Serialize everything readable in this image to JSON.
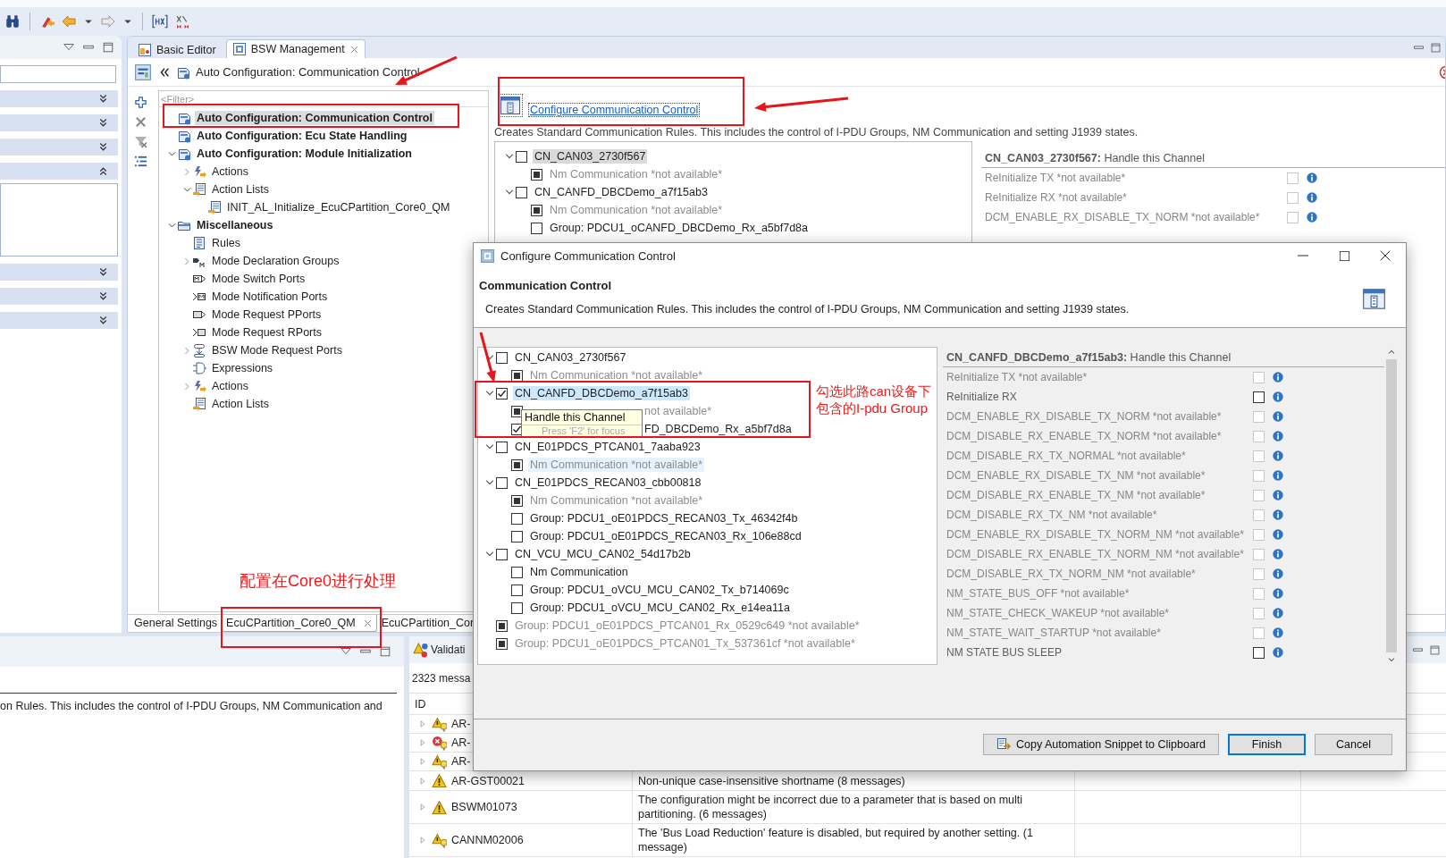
{
  "left_panel": {
    "sections": [
      {
        "expanded": false
      },
      {
        "expanded": false
      },
      {
        "expanded": false
      },
      {
        "expanded": true
      },
      {
        "expanded": false
      },
      {
        "expanded": false
      },
      {
        "expanded": false
      }
    ]
  },
  "editor": {
    "tabs": [
      {
        "label": "Basic Editor",
        "selected": false,
        "closable": false
      },
      {
        "label": "BSW Management",
        "selected": true,
        "closable": true
      }
    ],
    "breadcrumb": "Auto Configuration: Communication Control",
    "filter": {
      "placeholder": "<Filter>"
    },
    "tree": [
      {
        "label": "Auto Configuration: Communication Control",
        "kind": "autoconfig",
        "bold": true,
        "selected": true
      },
      {
        "label": "Auto Configuration: Ecu State Handling",
        "kind": "autoconfig",
        "bold": true,
        "selected": false
      },
      {
        "label": "Auto Configuration: Module Initialization",
        "kind": "autoconfig",
        "bold": true,
        "selected": false,
        "expanded": true,
        "children": [
          {
            "label": "Actions",
            "kind": "actions",
            "bold": false,
            "selected": false,
            "expanded": false
          },
          {
            "label": "Action Lists",
            "kind": "action-list",
            "bold": false,
            "selected": false,
            "expanded": true,
            "children": [
              {
                "label": "INIT_AL_Initialize_EcuCPartition_Core0_QM",
                "kind": "action-list",
                "bold": false,
                "selected": false
              }
            ]
          }
        ]
      },
      {
        "label": "Miscellaneous",
        "kind": "folder",
        "bold": true,
        "selected": false,
        "expanded": true,
        "children": [
          {
            "label": "Rules",
            "kind": "rules",
            "bold": false,
            "selected": false
          },
          {
            "label": "Mode Declaration Groups",
            "kind": "mode-group",
            "bold": false,
            "selected": false,
            "expanded": false
          },
          {
            "label": "Mode Switch Ports",
            "kind": "mode-switch",
            "bold": false,
            "selected": false
          },
          {
            "label": "Mode Notification Ports",
            "kind": "mode-notification",
            "bold": false,
            "selected": false
          },
          {
            "label": "Mode Request PPorts",
            "kind": "mode-request-p",
            "bold": false,
            "selected": false
          },
          {
            "label": "Mode Request RPorts",
            "kind": "mode-request-r",
            "bold": false,
            "selected": false
          },
          {
            "label": "BSW Mode Request Ports",
            "kind": "bsw-request",
            "bold": false,
            "selected": false,
            "expanded": false
          },
          {
            "label": "Expressions",
            "kind": "expression",
            "bold": false,
            "selected": false
          },
          {
            "label": "Actions",
            "kind": "actions",
            "bold": false,
            "selected": false,
            "expanded": false
          },
          {
            "label": "Action Lists",
            "kind": "action-list",
            "bold": false,
            "selected": false
          }
        ]
      }
    ],
    "link": "Configure Communication Control",
    "description": "Creates Standard Communication Rules. This includes the control of I-PDU Groups, NM Communication and setting J1939 states.",
    "channels": [
      {
        "label": "CN_CAN03_2730f567",
        "checked": false,
        "available": true,
        "selected": true,
        "expanded": true,
        "children": [
          {
            "label": "Nm Communication *not available*",
            "checked": false,
            "available": false,
            "selected": false
          }
        ]
      },
      {
        "label": "CN_CANFD_DBCDemo_a7f15ab3",
        "checked": false,
        "available": true,
        "selected": false,
        "expanded": true,
        "children": [
          {
            "label": "Nm Communication *not available*",
            "checked": false,
            "available": false,
            "selected": false
          },
          {
            "label": "Group: PDCU1_oCANFD_DBCDemo_Rx_a5bf7d8a",
            "checked": false,
            "available": true,
            "selected": false
          }
        ]
      }
    ],
    "detail": {
      "heading": "**CN_CAN03_2730f567:** Handle this Channel",
      "rows": [
        {
          "label": "ReInitialize TX *not available*",
          "checked": false,
          "available": false
        },
        {
          "label": "ReInitialize RX *not available*",
          "checked": false,
          "available": false
        },
        {
          "label": "DCM_ENABLE_RX_DISABLE_TX_NORM *not available*",
          "checked": false,
          "available": false
        }
      ]
    },
    "bottom_tabs": [
      {
        "label": "General Settings",
        "selected": false,
        "closable": false
      },
      {
        "label": "EcuCPartition_Core0_QM",
        "selected": true,
        "closable": true
      },
      {
        "label": "EcuCPartition_Cor",
        "selected": false,
        "closable": false
      }
    ]
  },
  "properties": {
    "text": "on Rules. This includes the control of I-PDU Groups, NM Communication and"
  },
  "validation": {
    "title": "Validati",
    "summary": "2323 messa",
    "columns": [
      "ID"
    ],
    "rows": [
      {
        "id": "AR-",
        "kind": "warning-hint",
        "expanded": false
      },
      {
        "id": "AR-",
        "kind": "error-hint",
        "expanded": false
      },
      {
        "id": "AR-",
        "kind": "warning-hint",
        "expanded": false
      },
      {
        "id": "AR-GST00021",
        "kind": "warning",
        "expanded": false,
        "description": "Non-unique case-insensitive shortname (8 messages)"
      },
      {
        "id": "BSWM01073",
        "kind": "warning",
        "expanded": false,
        "description": "The configuration might be incorrect due to a parameter that is based on multi partitioning. (6 messages)"
      },
      {
        "id": "CANNM02006",
        "kind": "warning-hint",
        "expanded": false,
        "description": "The 'Bus Load Reduction' feature is disabled, but required by another setting. (1 message)"
      }
    ]
  },
  "dialog": {
    "title": "Configure Communication Control",
    "heading": "Communication Control",
    "description": "Creates Standard Communication Rules. This includes the control of I-PDU Groups, NM Communication and setting J1939 states.",
    "channels": [
      {
        "label": "CN_CAN03_2730f567",
        "checked": false,
        "available": true,
        "selected": false,
        "hovered": false,
        "expanded": true,
        "children": [
          {
            "label": "Nm Communication *not available*",
            "checked": false,
            "available": false,
            "selected": false,
            "hovered": false
          }
        ]
      },
      {
        "label": "CN_CANFD_DBCDemo_a7f15ab3",
        "checked": true,
        "available": true,
        "selected": true,
        "hovered": false,
        "expanded": true,
        "children": [
          {
            "label": "not available*",
            "checked": false,
            "available": false,
            "selected": false,
            "hovered": false,
            "covered": true
          },
          {
            "label": "FD_DBCDemo_Rx_a5bf7d8a",
            "checked": true,
            "available": true,
            "selected": false,
            "hovered": false,
            "covered": true
          }
        ]
      },
      {
        "label": "CN_E01PDCS_PTCAN01_7aaba923",
        "checked": false,
        "available": true,
        "selected": false,
        "hovered": false,
        "expanded": true,
        "children": [
          {
            "label": "Nm Communication *not available*",
            "checked": false,
            "available": false,
            "selected": false,
            "hovered": true
          }
        ]
      },
      {
        "label": "CN_E01PDCS_RECAN03_cbb00818",
        "checked": false,
        "available": true,
        "selected": false,
        "hovered": false,
        "expanded": true,
        "children": [
          {
            "label": "Nm Communication *not available*",
            "checked": false,
            "available": false,
            "selected": false,
            "hovered": false
          },
          {
            "label": "Group: PDCU1_oE01PDCS_RECAN03_Tx_46342f4b",
            "checked": false,
            "available": true,
            "selected": false,
            "hovered": false
          },
          {
            "label": "Group: PDCU1_oE01PDCS_RECAN03_Rx_106e88cd",
            "checked": false,
            "available": true,
            "selected": false,
            "hovered": false
          }
        ]
      },
      {
        "label": "CN_VCU_MCU_CAN02_54d17b2b",
        "checked": false,
        "available": true,
        "selected": false,
        "hovered": false,
        "expanded": true,
        "children": [
          {
            "label": "Nm Communication",
            "checked": false,
            "available": true,
            "selected": false,
            "hovered": false
          },
          {
            "label": "Group: PDCU1_oVCU_MCU_CAN02_Tx_b714069c",
            "checked": false,
            "available": true,
            "selected": false,
            "hovered": false
          },
          {
            "label": "Group: PDCU1_oVCU_MCU_CAN02_Rx_e14ea11a",
            "checked": false,
            "available": true,
            "selected": false,
            "hovered": false
          }
        ]
      },
      {
        "label": "Group: PDCU1_oE01PDCS_PTCAN01_Rx_0529c649 *not available*",
        "checked": false,
        "available": false,
        "selected": false,
        "hovered": false
      },
      {
        "label": "Group: PDCU1_oE01PDCS_PTCAN01_Tx_537361cf *not available*",
        "checked": false,
        "available": false,
        "selected": false,
        "hovered": false
      }
    ],
    "tooltip": {
      "title": "Handle this Channel",
      "hint": "Press 'F2' for focus"
    },
    "detail": {
      "heading": "**CN_CANFD_DBCDemo_a7f15ab3:** Handle this Channel",
      "rows": [
        {
          "label": "ReInitialize TX *not available*",
          "checked": false,
          "available": false
        },
        {
          "label": "ReInitialize RX",
          "checked": false,
          "available": true
        },
        {
          "label": "DCM_ENABLE_RX_DISABLE_TX_NORM *not available*",
          "checked": false,
          "available": false
        },
        {
          "label": "DCM_DISABLE_RX_ENABLE_TX_NORM *not available*",
          "checked": false,
          "available": false
        },
        {
          "label": "DCM_DISABLE_RX_TX_NORMAL *not available*",
          "checked": false,
          "available": false
        },
        {
          "label": "DCM_ENABLE_RX_DISABLE_TX_NM *not available*",
          "checked": false,
          "available": false
        },
        {
          "label": "DCM_DISABLE_RX_ENABLE_TX_NM *not available*",
          "checked": false,
          "available": false
        },
        {
          "label": "DCM_DISABLE_RX_TX_NM *not available*",
          "checked": false,
          "available": false
        },
        {
          "label": "DCM_ENABLE_RX_DISABLE_TX_NORM_NM *not available*",
          "checked": false,
          "available": false
        },
        {
          "label": "DCM_DISABLE_RX_ENABLE_TX_NORM_NM *not available*",
          "checked": false,
          "available": false
        },
        {
          "label": "DCM_DISABLE_RX_TX_NORM_NM *not available*",
          "checked": false,
          "available": false
        },
        {
          "label": "NM_STATE_BUS_OFF *not available*",
          "checked": false,
          "available": false
        },
        {
          "label": "NM_STATE_CHECK_WAKEUP *not available*",
          "checked": false,
          "available": false
        },
        {
          "label": "NM_STATE_WAIT_STARTUP *not available*",
          "checked": false,
          "available": false
        },
        {
          "label": "NM STATE BUS SLEEP",
          "checked": false,
          "available": true
        }
      ]
    },
    "buttons": [
      {
        "label": "Copy Automation Snippet to Clipboard",
        "kind": "copy"
      },
      {
        "label": "Finish",
        "kind": "default"
      },
      {
        "label": "Cancel",
        "kind": "plain"
      }
    ]
  },
  "annotations": [
    {
      "text": "勾选此路can设备下包含的I-pdu Group"
    },
    {
      "text": "配置在Core0进行处理"
    }
  ]
}
